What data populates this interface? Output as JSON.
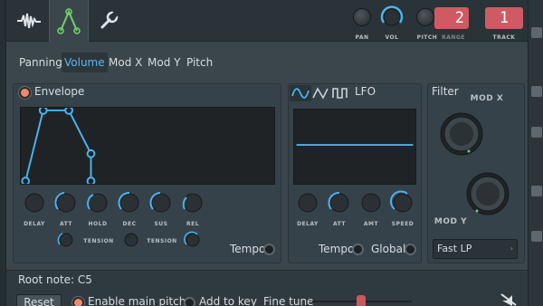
{
  "toolbar": {
    "tabs": [
      {
        "name": "plugin",
        "icon": "waveform-icon"
      },
      {
        "name": "envelopes",
        "icon": "envelope-lfo-icon"
      },
      {
        "name": "misc",
        "icon": "wrench-icon"
      }
    ],
    "knobs": {
      "pan": "PAN",
      "vol": "VOL",
      "pitch": "PITCH",
      "range": "RANGE",
      "track": "TRACK"
    },
    "range_value": "2",
    "track_value": "1"
  },
  "targets": {
    "panning": "Panning",
    "volume": "Volume",
    "mod_x": "Mod X",
    "mod_y": "Mod Y",
    "pitch": "Pitch",
    "selected": "Volume"
  },
  "envelope": {
    "title": "Envelope",
    "enabled": true,
    "knobs": [
      "DELAY",
      "ATT",
      "HOLD",
      "DEC",
      "SUS",
      "REL"
    ],
    "tension_label": "TENSION",
    "tempo_label": "Tempo"
  },
  "lfo": {
    "title": "LFO",
    "shapes": [
      "sine-wave-icon",
      "triangle-wave-icon",
      "square-wave-icon"
    ],
    "knobs": [
      "DELAY",
      "ATT",
      "AMT",
      "SPEED"
    ],
    "tempo_label": "Tempo",
    "global_label": "Global"
  },
  "filter": {
    "title": "Filter",
    "mod_x": "MOD X",
    "mod_y": "MOD Y",
    "type": "Fast LP"
  },
  "root": {
    "label": "Root note: C5",
    "reset": "Reset",
    "enable_main_pitch": "Enable main pitch",
    "add_to_key": "Add to key",
    "fine_tune": "Fine tune"
  },
  "colors": {
    "accent": "#5fb8ee",
    "track": "#cf5a63",
    "toggle_on": "#f08a6a"
  }
}
